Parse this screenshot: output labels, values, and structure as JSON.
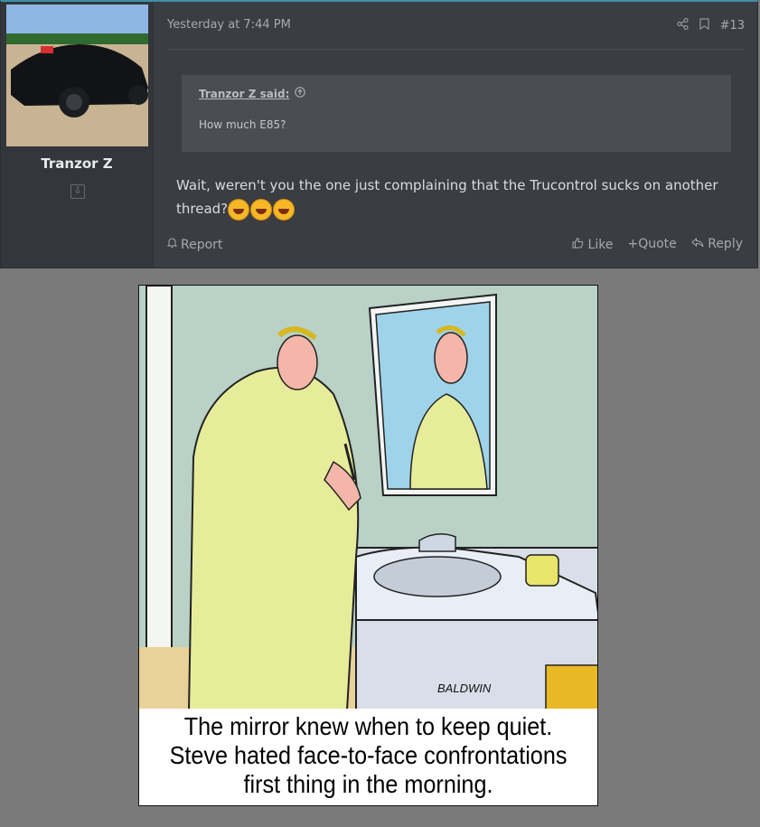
{
  "post": {
    "author": "Tranzor Z",
    "date": "Yesterday at 7:44 PM",
    "post_number": "#13",
    "quote": {
      "author_label": "Tranzor Z said:",
      "text": "How much E85?"
    },
    "message": "Wait, weren't you the one just complaining that the Trucontrol sucks on another thread?",
    "actions": {
      "report": "Report",
      "like": "Like",
      "quote": "Quote",
      "reply": "Reply"
    }
  },
  "comic": {
    "signature": "BALDWIN",
    "caption_lines": [
      "The mirror knew when to keep quiet.",
      "Steve hated face-to-face confrontations",
      "first thing in the morning."
    ]
  },
  "colors": {
    "accent": "#3d8fa8",
    "post_bg": "#3a3d42",
    "page_bg": "#7a7a7a"
  }
}
